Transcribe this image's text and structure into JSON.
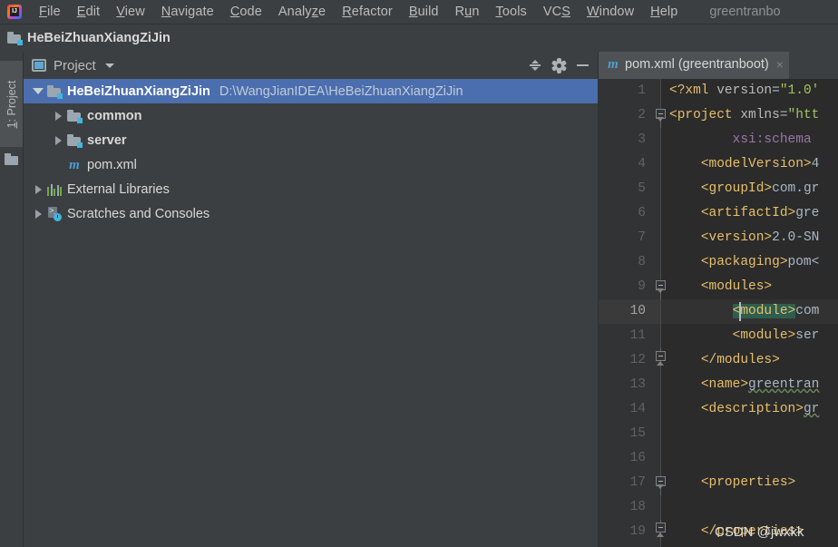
{
  "menubar": {
    "logo": "intellij-idea-logo",
    "items": [
      {
        "pre": "",
        "mn": "F",
        "post": "ile"
      },
      {
        "pre": "",
        "mn": "E",
        "post": "dit"
      },
      {
        "pre": "",
        "mn": "V",
        "post": "iew"
      },
      {
        "pre": "",
        "mn": "N",
        "post": "avigate"
      },
      {
        "pre": "",
        "mn": "C",
        "post": "ode"
      },
      {
        "pre": "Analy",
        "mn": "z",
        "post": "e"
      },
      {
        "pre": "",
        "mn": "R",
        "post": "efactor"
      },
      {
        "pre": "",
        "mn": "B",
        "post": "uild"
      },
      {
        "pre": "R",
        "mn": "u",
        "post": "n"
      },
      {
        "pre": "",
        "mn": "T",
        "post": "ools"
      },
      {
        "pre": "VC",
        "mn": "S",
        "post": ""
      },
      {
        "pre": "",
        "mn": "W",
        "post": "indow"
      },
      {
        "pre": "",
        "mn": "H",
        "post": "elp"
      }
    ],
    "window_title": "greentranbo"
  },
  "navbar": {
    "project_name": "HeBeiZhuanXiangZiJin"
  },
  "stripe": {
    "project_button": {
      "prefix": "1",
      "mnemonic": "1",
      "label": "1: Project"
    }
  },
  "project_panel": {
    "title": "Project",
    "tools": {
      "collapse_all": "Collapse All",
      "settings": "Settings",
      "hide": "Hide"
    },
    "tree": [
      {
        "label": "HeBeiZhuanXiangZiJin",
        "path": "D:\\WangJianIDEA\\HeBeiZhuanXiangZiJin",
        "icon": "folder-module-icon",
        "arrow": "open",
        "indent": 0,
        "bold": true,
        "selected": true
      },
      {
        "label": "common",
        "path": "",
        "icon": "folder-module-icon",
        "arrow": "closed",
        "indent": 1,
        "bold": true,
        "selected": false
      },
      {
        "label": "server",
        "path": "",
        "icon": "folder-module-icon",
        "arrow": "closed",
        "indent": 1,
        "bold": true,
        "selected": false
      },
      {
        "label": "pom.xml",
        "path": "",
        "icon": "maven-m-icon",
        "arrow": "none",
        "indent": 1,
        "bold": false,
        "selected": false
      },
      {
        "label": "External Libraries",
        "path": "",
        "icon": "library-bars-icon",
        "arrow": "closed",
        "indent": 0,
        "bold": false,
        "selected": false
      },
      {
        "label": "Scratches and Consoles",
        "path": "",
        "icon": "scratches-icon",
        "arrow": "closed",
        "indent": 0,
        "bold": false,
        "selected": false
      }
    ]
  },
  "editor": {
    "tab": {
      "icon": "maven-m-icon",
      "label": "pom.xml (greentranboot)",
      "close": "×"
    },
    "watermark": "CSDN @jwxkk",
    "lines": [
      {
        "num": "1",
        "fold": "none",
        "current": false,
        "spans": [
          {
            "t": "<?xml ",
            "c": "tag",
            "indent": 0
          },
          {
            "t": "version",
            "c": "attr"
          },
          {
            "t": "=",
            "c": "plain"
          },
          {
            "t": "\"1.0'",
            "c": "val"
          }
        ]
      },
      {
        "num": "2",
        "fold": "start",
        "current": false,
        "spans": [
          {
            "t": "<project ",
            "c": "tag"
          },
          {
            "t": "xmlns",
            "c": "attr"
          },
          {
            "t": "=",
            "c": "plain"
          },
          {
            "t": "\"htt",
            "c": "val"
          }
        ]
      },
      {
        "num": "3",
        "fold": "none",
        "current": false,
        "spans": [
          {
            "t": "        ",
            "c": "plain"
          },
          {
            "t": "xsi:schema",
            "c": "ns"
          }
        ]
      },
      {
        "num": "4",
        "fold": "none",
        "current": false,
        "spans": [
          {
            "t": "    ",
            "c": "plain"
          },
          {
            "t": "<modelVersion>",
            "c": "tag"
          },
          {
            "t": "4",
            "c": "txt"
          }
        ]
      },
      {
        "num": "5",
        "fold": "none",
        "current": false,
        "spans": [
          {
            "t": "    ",
            "c": "plain"
          },
          {
            "t": "<groupId>",
            "c": "tag"
          },
          {
            "t": "com.gr",
            "c": "txt"
          }
        ]
      },
      {
        "num": "6",
        "fold": "none",
        "current": false,
        "spans": [
          {
            "t": "    ",
            "c": "plain"
          },
          {
            "t": "<artifactId>",
            "c": "tag"
          },
          {
            "t": "gre",
            "c": "txt"
          }
        ]
      },
      {
        "num": "7",
        "fold": "none",
        "current": false,
        "spans": [
          {
            "t": "    ",
            "c": "plain"
          },
          {
            "t": "<version>",
            "c": "tag"
          },
          {
            "t": "2.0-SN",
            "c": "txt"
          }
        ]
      },
      {
        "num": "8",
        "fold": "none",
        "current": false,
        "spans": [
          {
            "t": "    ",
            "c": "plain"
          },
          {
            "t": "<packaging>",
            "c": "tag"
          },
          {
            "t": "pom<",
            "c": "txt"
          }
        ]
      },
      {
        "num": "9",
        "fold": "start",
        "current": false,
        "spans": [
          {
            "t": "    ",
            "c": "plain"
          },
          {
            "t": "<modules>",
            "c": "tag"
          }
        ]
      },
      {
        "num": "10",
        "fold": "none",
        "current": true,
        "spans": [
          {
            "t": "        ",
            "c": "plain"
          },
          {
            "t": "<module>",
            "c": "tag sel-hl"
          },
          {
            "t": "com",
            "c": "txt"
          }
        ]
      },
      {
        "num": "11",
        "fold": "none",
        "current": false,
        "spans": [
          {
            "t": "        ",
            "c": "plain"
          },
          {
            "t": "<module>",
            "c": "tag"
          },
          {
            "t": "ser",
            "c": "txt"
          }
        ]
      },
      {
        "num": "12",
        "fold": "end",
        "current": false,
        "spans": [
          {
            "t": "    ",
            "c": "plain"
          },
          {
            "t": "</modules>",
            "c": "tag"
          }
        ]
      },
      {
        "num": "13",
        "fold": "none",
        "current": false,
        "spans": [
          {
            "t": "    ",
            "c": "plain"
          },
          {
            "t": "<name>",
            "c": "tag"
          },
          {
            "t": "greentran",
            "c": "txt squiggle"
          }
        ]
      },
      {
        "num": "14",
        "fold": "none",
        "current": false,
        "spans": [
          {
            "t": "    ",
            "c": "plain"
          },
          {
            "t": "<description>",
            "c": "tag"
          },
          {
            "t": "gr",
            "c": "txt squiggle"
          }
        ]
      },
      {
        "num": "15",
        "fold": "none",
        "current": false,
        "spans": []
      },
      {
        "num": "16",
        "fold": "none",
        "current": false,
        "spans": []
      },
      {
        "num": "17",
        "fold": "start",
        "current": false,
        "spans": [
          {
            "t": "    ",
            "c": "plain"
          },
          {
            "t": "<properties>",
            "c": "tag"
          }
        ]
      },
      {
        "num": "18",
        "fold": "none",
        "current": false,
        "spans": []
      },
      {
        "num": "19",
        "fold": "end",
        "current": false,
        "spans": [
          {
            "t": "    ",
            "c": "plain"
          },
          {
            "t": "</properties>",
            "c": "tag"
          }
        ]
      }
    ]
  },
  "colors": {
    "chrome_bg": "#3c3f41",
    "editor_bg": "#2b2b2b",
    "gutter_bg": "#313335",
    "selection_blue": "#4b6eaf",
    "tag_gold": "#e8bf6a",
    "string_green": "#a5c261",
    "accent_cyan": "#40b6e0"
  }
}
